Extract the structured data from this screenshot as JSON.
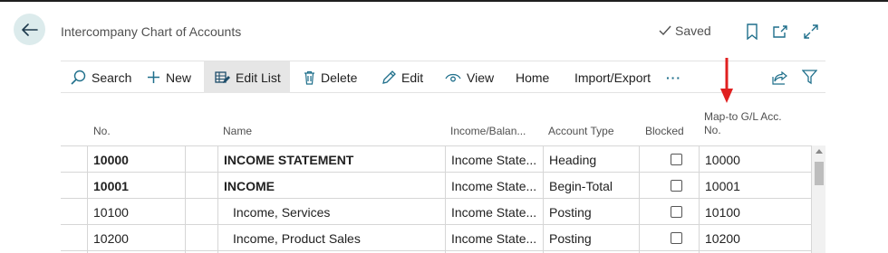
{
  "header": {
    "title": "Intercompany Chart of Accounts",
    "saved_label": "Saved",
    "icons": [
      "back-arrow-icon",
      "checkmark-icon",
      "bookmark-icon",
      "open-new-window-icon",
      "expand-icon"
    ]
  },
  "actions": {
    "search": "Search",
    "new": "New",
    "edit_list": "Edit List",
    "delete": "Delete",
    "edit": "Edit",
    "view": "View",
    "home": "Home",
    "import_export": "Import/Export",
    "more": "···"
  },
  "columns": {
    "no": "No.",
    "name": "Name",
    "income_balance": "Income/Balan...",
    "account_type": "Account Type",
    "blocked": "Blocked",
    "map_to_line1": "Map-to G/L Acc.",
    "map_to_line2": "No."
  },
  "rows": [
    {
      "no": "10000",
      "name": "INCOME STATEMENT",
      "income_balance": "Income State...",
      "account_type": "Heading",
      "map_to": "10000"
    },
    {
      "no": "10001",
      "name": "INCOME",
      "income_balance": "Income State...",
      "account_type": "Begin-Total",
      "map_to": "10001"
    },
    {
      "no": "10100",
      "name": "Income, Services",
      "income_balance": "Income State...",
      "account_type": "Posting",
      "map_to": "10100"
    },
    {
      "no": "10200",
      "name": "Income, Product Sales",
      "income_balance": "Income State...",
      "account_type": "Posting",
      "map_to": "10200"
    }
  ],
  "colors": {
    "annotation_arrow": "#e02020",
    "back_button_bg": "#dcebec",
    "icon_accent": "#1f6f8b"
  }
}
